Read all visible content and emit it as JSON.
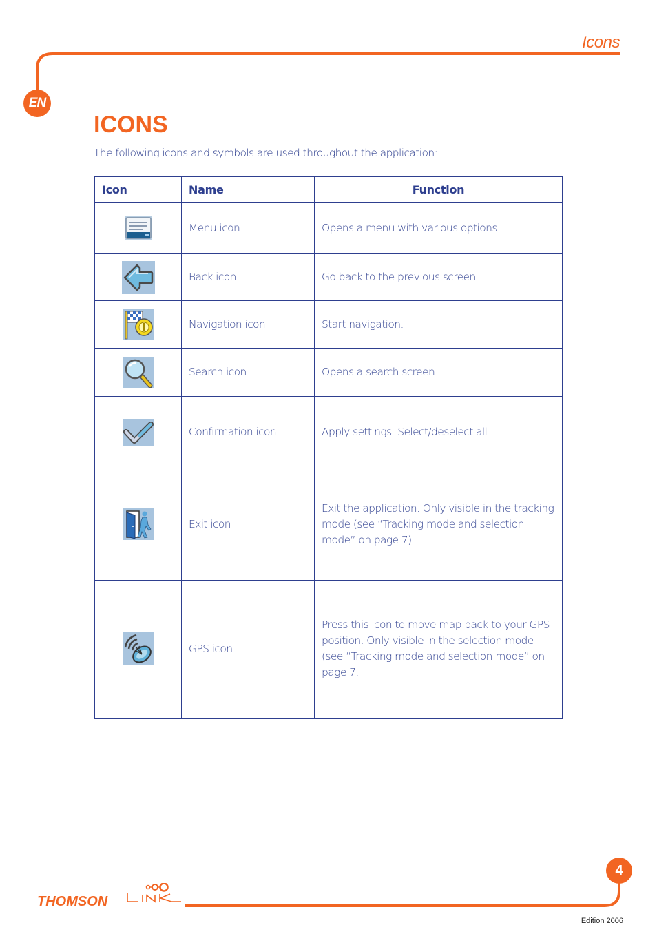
{
  "header": {
    "section_title": "Icons",
    "language_badge": "EN"
  },
  "page": {
    "title": "ICONS",
    "intro": "The following icons and symbols are used throughout the application:"
  },
  "table": {
    "columns": [
      "Icon",
      "Name",
      "Function"
    ],
    "rows": [
      {
        "icon": "menu-icon",
        "name": "Menu icon",
        "function": "Opens a menu with various options."
      },
      {
        "icon": "back-icon",
        "name": "Back icon",
        "function": "Go back to the previous screen."
      },
      {
        "icon": "navigation-icon",
        "name": "Navigation icon",
        "function": "Start navigation."
      },
      {
        "icon": "search-icon",
        "name": "Search icon",
        "function": "Opens a search screen."
      },
      {
        "icon": "confirmation-icon",
        "name": "Confirmation icon",
        "function": "Apply settings. Select/deselect all."
      },
      {
        "icon": "exit-icon",
        "name": "Exit icon",
        "function": "Exit the application. Only visible in the tracking mode (see “Tracking mode and selection mode” on page 7)."
      },
      {
        "icon": "gps-icon",
        "name": "GPS icon",
        "function": "Press this icon to move map back to your GPS position. Only visible in the selection mode (see “Tracking mode and selection mode” on page 7."
      }
    ]
  },
  "footer": {
    "brand_primary": "THOMSON",
    "brand_secondary": "LINK",
    "page_number": "4",
    "edition": "Edition 2006"
  },
  "colors": {
    "accent_orange": "#f26522",
    "text_blue": "#2e3f8f",
    "icon_bg": "#a8c4de"
  }
}
